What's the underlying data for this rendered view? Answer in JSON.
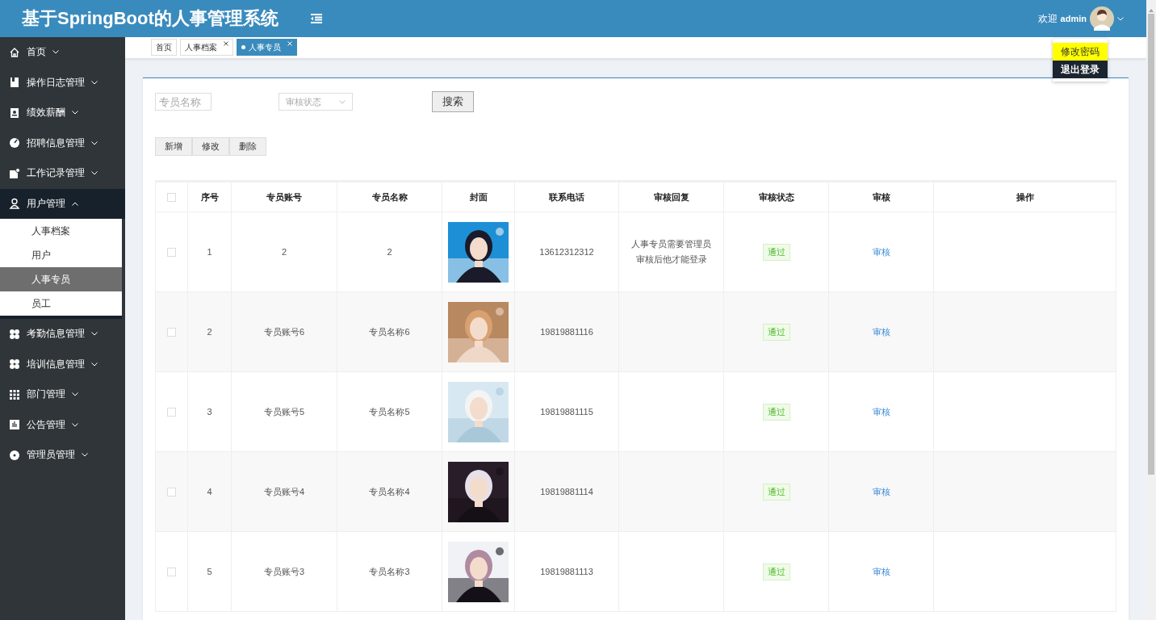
{
  "header": {
    "title": "基于SpringBoot的人事管理系统",
    "welcome": "欢迎",
    "user": "admin"
  },
  "user_menu": [
    {
      "label": "修改密码",
      "hovered": true
    },
    {
      "label": "退出登录",
      "hovered": false
    }
  ],
  "sidebar": {
    "items": [
      {
        "label": "首页",
        "expanded": false
      },
      {
        "label": "操作日志管理",
        "expanded": false
      },
      {
        "label": "绩效薪酬",
        "expanded": false
      },
      {
        "label": "招聘信息管理",
        "expanded": false
      },
      {
        "label": "工作记录管理",
        "expanded": false
      },
      {
        "label": "用户管理",
        "expanded": true,
        "children": [
          {
            "label": "人事档案",
            "selected": false
          },
          {
            "label": "用户",
            "selected": false
          },
          {
            "label": "人事专员",
            "selected": true
          },
          {
            "label": "员工",
            "selected": false
          }
        ]
      },
      {
        "label": "考勤信息管理",
        "expanded": false
      },
      {
        "label": "培训信息管理",
        "expanded": false
      },
      {
        "label": "部门管理",
        "expanded": false
      },
      {
        "label": "公告管理",
        "expanded": false
      },
      {
        "label": "管理员管理",
        "expanded": false
      }
    ]
  },
  "tabs": [
    {
      "label": "首页",
      "selected": false,
      "closable": false
    },
    {
      "label": "人事档案",
      "selected": false,
      "closable": true
    },
    {
      "label": "人事专员",
      "selected": true,
      "closable": true
    }
  ],
  "search": {
    "name_placeholder": "专员名称",
    "status_placeholder": "审核状态",
    "button": "搜索"
  },
  "actions": [
    "新增",
    "修改",
    "删除"
  ],
  "table": {
    "all_checked": false,
    "columns": [
      "序号",
      "专员账号",
      "专员名称",
      "封面",
      "联系电话",
      "审核回复",
      "审核状态",
      "审核",
      "操作"
    ],
    "rows": [
      {
        "checked": false,
        "no": "1",
        "account": "2",
        "name": "2",
        "phone": "13612312312",
        "reply": "人事专员需要管理员审核后他才能登录",
        "status": "通过",
        "audit": "审核"
      },
      {
        "checked": false,
        "no": "2",
        "account": "专员账号6",
        "name": "专员名称6",
        "phone": "19819881116",
        "status": "通过",
        "audit": "审核"
      },
      {
        "checked": false,
        "no": "3",
        "account": "专员账号5",
        "name": "专员名称5",
        "phone": "19819881115",
        "status": "通过",
        "audit": "审核"
      },
      {
        "checked": false,
        "no": "4",
        "account": "专员账号4",
        "name": "专员名称4",
        "phone": "19819881114",
        "status": "通过",
        "audit": "审核"
      },
      {
        "checked": false,
        "no": "5",
        "account": "专员账号3",
        "name": "专员名称3",
        "phone": "19819881113",
        "status": "通过",
        "audit": "审核"
      }
    ]
  }
}
